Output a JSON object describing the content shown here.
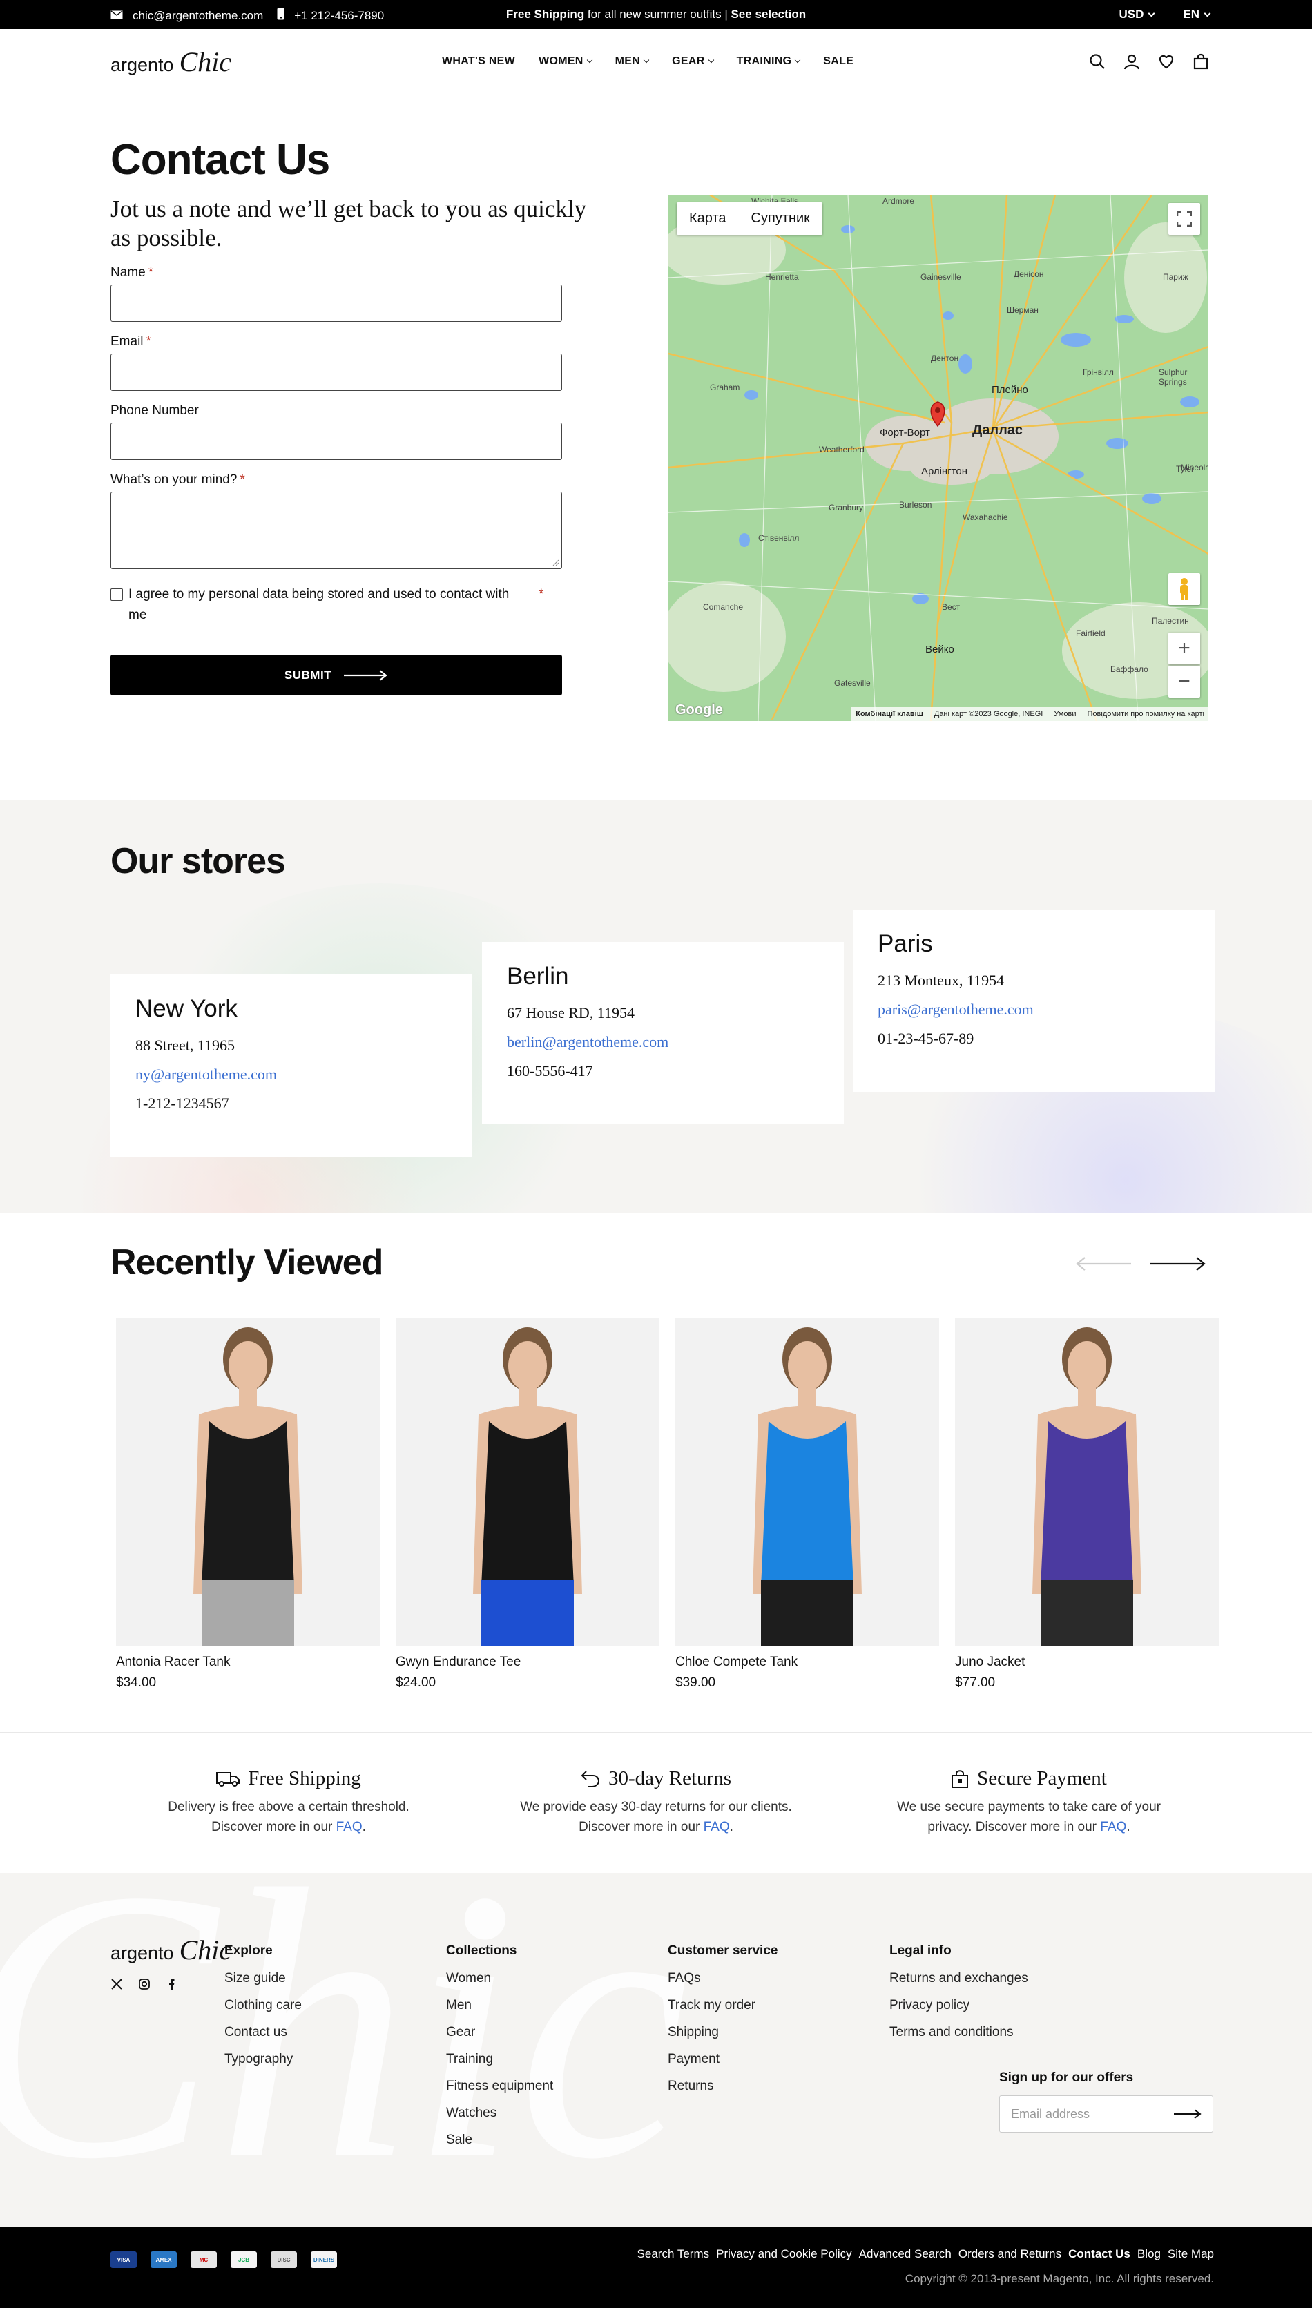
{
  "topbar": {
    "email": "chic@argentotheme.com",
    "phone": "+1 212-456-7890",
    "promo_bold": "Free Shipping",
    "promo_rest": " for all new summer outfits | ",
    "promo_link": "See selection",
    "currency": "USD",
    "language": "EN"
  },
  "header": {
    "logo_text": "argento",
    "logo_script": "Chic",
    "nav": [
      "WHAT'S NEW",
      "WOMEN",
      "MEN",
      "GEAR",
      "TRAINING",
      "SALE"
    ],
    "nav_dropdown": [
      false,
      true,
      true,
      true,
      true,
      false
    ]
  },
  "contact": {
    "title": "Contact Us",
    "subtitle": "Jot us a note and we’ll get back to you as quickly as possible.",
    "name_label": "Name",
    "email_label": "Email",
    "phone_label": "Phone Number",
    "message_label": "What’s on your mind?",
    "required_mark": "*",
    "consent_text": "I agree to my personal data being stored and used to contact with me",
    "submit_label": "SUBMIT"
  },
  "map": {
    "tab_map": "Карта",
    "tab_satellite": "Супутник",
    "zoom_in": "+",
    "zoom_out": "−",
    "footer_shortcuts": "Комбінації клавіш",
    "footer_data": "Дані карт ©2023 Google, INEGI",
    "footer_terms": "Умови",
    "footer_report": "Повідомити про помилку на карті",
    "google": "Google",
    "labels": {
      "dallas": "Даллас",
      "fort_worth": "Форт-Ворт",
      "arlington": "Арлінгтон",
      "plano": "Плейно",
      "waco": "Вейко",
      "denton": "Дентон",
      "ardmore": "Ardmore",
      "wichita_falls": "Wichita Falls",
      "sherman": "Шерман",
      "greenville": "Грінвілл",
      "paris": "Париж",
      "tyler": "Tyler",
      "palestine": "Палестин",
      "weatherford": "Weatherford",
      "granbury": "Granbury",
      "waxahachie": "Waxahachie",
      "stephenville": "Стівенвілл",
      "graham": "Graham",
      "fairfield": "Fairfield",
      "mineola": "Mineola",
      "gatesville": "Gatesville",
      "west": "Вест",
      "henrietta": "Henrietta",
      "gainesville": "Gainesville",
      "denison": "Денісон",
      "burleson": "Burleson",
      "comanche": "Comanche",
      "buffalo": "Баффало",
      "sulphur_springs": "Sulphur Springs"
    }
  },
  "stores": {
    "title": "Our stores",
    "items": [
      {
        "city": "New York",
        "address": "88 Street, 11965",
        "email": "ny@argentotheme.com",
        "phone": "1-212-1234567"
      },
      {
        "city": "Berlin",
        "address": "67 House RD, 11954",
        "email": "berlin@argentotheme.com",
        "phone": "160-5556-417"
      },
      {
        "city": "Paris",
        "address": "213 Monteux, 11954",
        "email": "paris@argentotheme.com",
        "phone": "01-23-45-67-89"
      }
    ]
  },
  "recently_viewed": {
    "title": "Recently Viewed",
    "products": [
      {
        "name": "Antonia Racer Tank",
        "price": "$34.00",
        "top_color": "#1a1a1a",
        "bottom_color": "#a9a9a9"
      },
      {
        "name": "Gwyn Endurance Tee",
        "price": "$24.00",
        "top_color": "#161616",
        "bottom_color": "#1d4fd1"
      },
      {
        "name": "Chloe Compete Tank",
        "price": "$39.00",
        "top_color": "#1b84e0",
        "bottom_color": "#1d1d1d"
      },
      {
        "name": "Juno Jacket",
        "price": "$77.00",
        "top_color": "#4b3aa0",
        "bottom_color": "#2a2a2a"
      }
    ]
  },
  "benefits": [
    {
      "icon": "truck-icon",
      "title": "Free Shipping",
      "text": "Delivery is free above a certain threshold. Discover more in our ",
      "link": "FAQ"
    },
    {
      "icon": "return-arrow-icon",
      "title": "30-day Returns",
      "text": "We provide easy 30-day returns for our clients. Discover more in our ",
      "link": "FAQ"
    },
    {
      "icon": "lock-bag-icon",
      "title": "Secure Payment",
      "text": "We use secure payments to take care of your privacy. Discover more in our ",
      "link": "FAQ"
    }
  ],
  "footer": {
    "logo_text": "argento",
    "logo_script": "Chic",
    "watermark": "Chic",
    "columns": [
      {
        "title": "Explore",
        "items": [
          "Size guide",
          "Clothing care",
          "Contact us",
          "Typography"
        ]
      },
      {
        "title": "Collections",
        "items": [
          "Women",
          "Men",
          "Gear",
          "Training",
          "Fitness equipment",
          "Watches",
          "Sale"
        ]
      },
      {
        "title": "Customer service",
        "items": [
          "FAQs",
          "Track my order",
          "Shipping",
          "Payment",
          "Returns"
        ]
      },
      {
        "title": "Legal info",
        "items": [
          "Returns and exchanges",
          "Privacy policy",
          "Terms and conditions"
        ]
      }
    ],
    "signup_title": "Sign up for our offers",
    "signup_placeholder": "Email address"
  },
  "bottombar": {
    "payment_icons": [
      "VISA",
      "AMEX",
      "MC",
      "JCB",
      "DISC",
      "DINERS"
    ],
    "links": [
      "Search Terms",
      "Privacy and Cookie Policy",
      "Advanced Search",
      "Orders and Returns",
      "Contact Us",
      "Blog",
      "Site Map"
    ],
    "active_link": "Contact Us",
    "copyright": "Copyright © 2013-present Magento, Inc. All rights reserved."
  }
}
